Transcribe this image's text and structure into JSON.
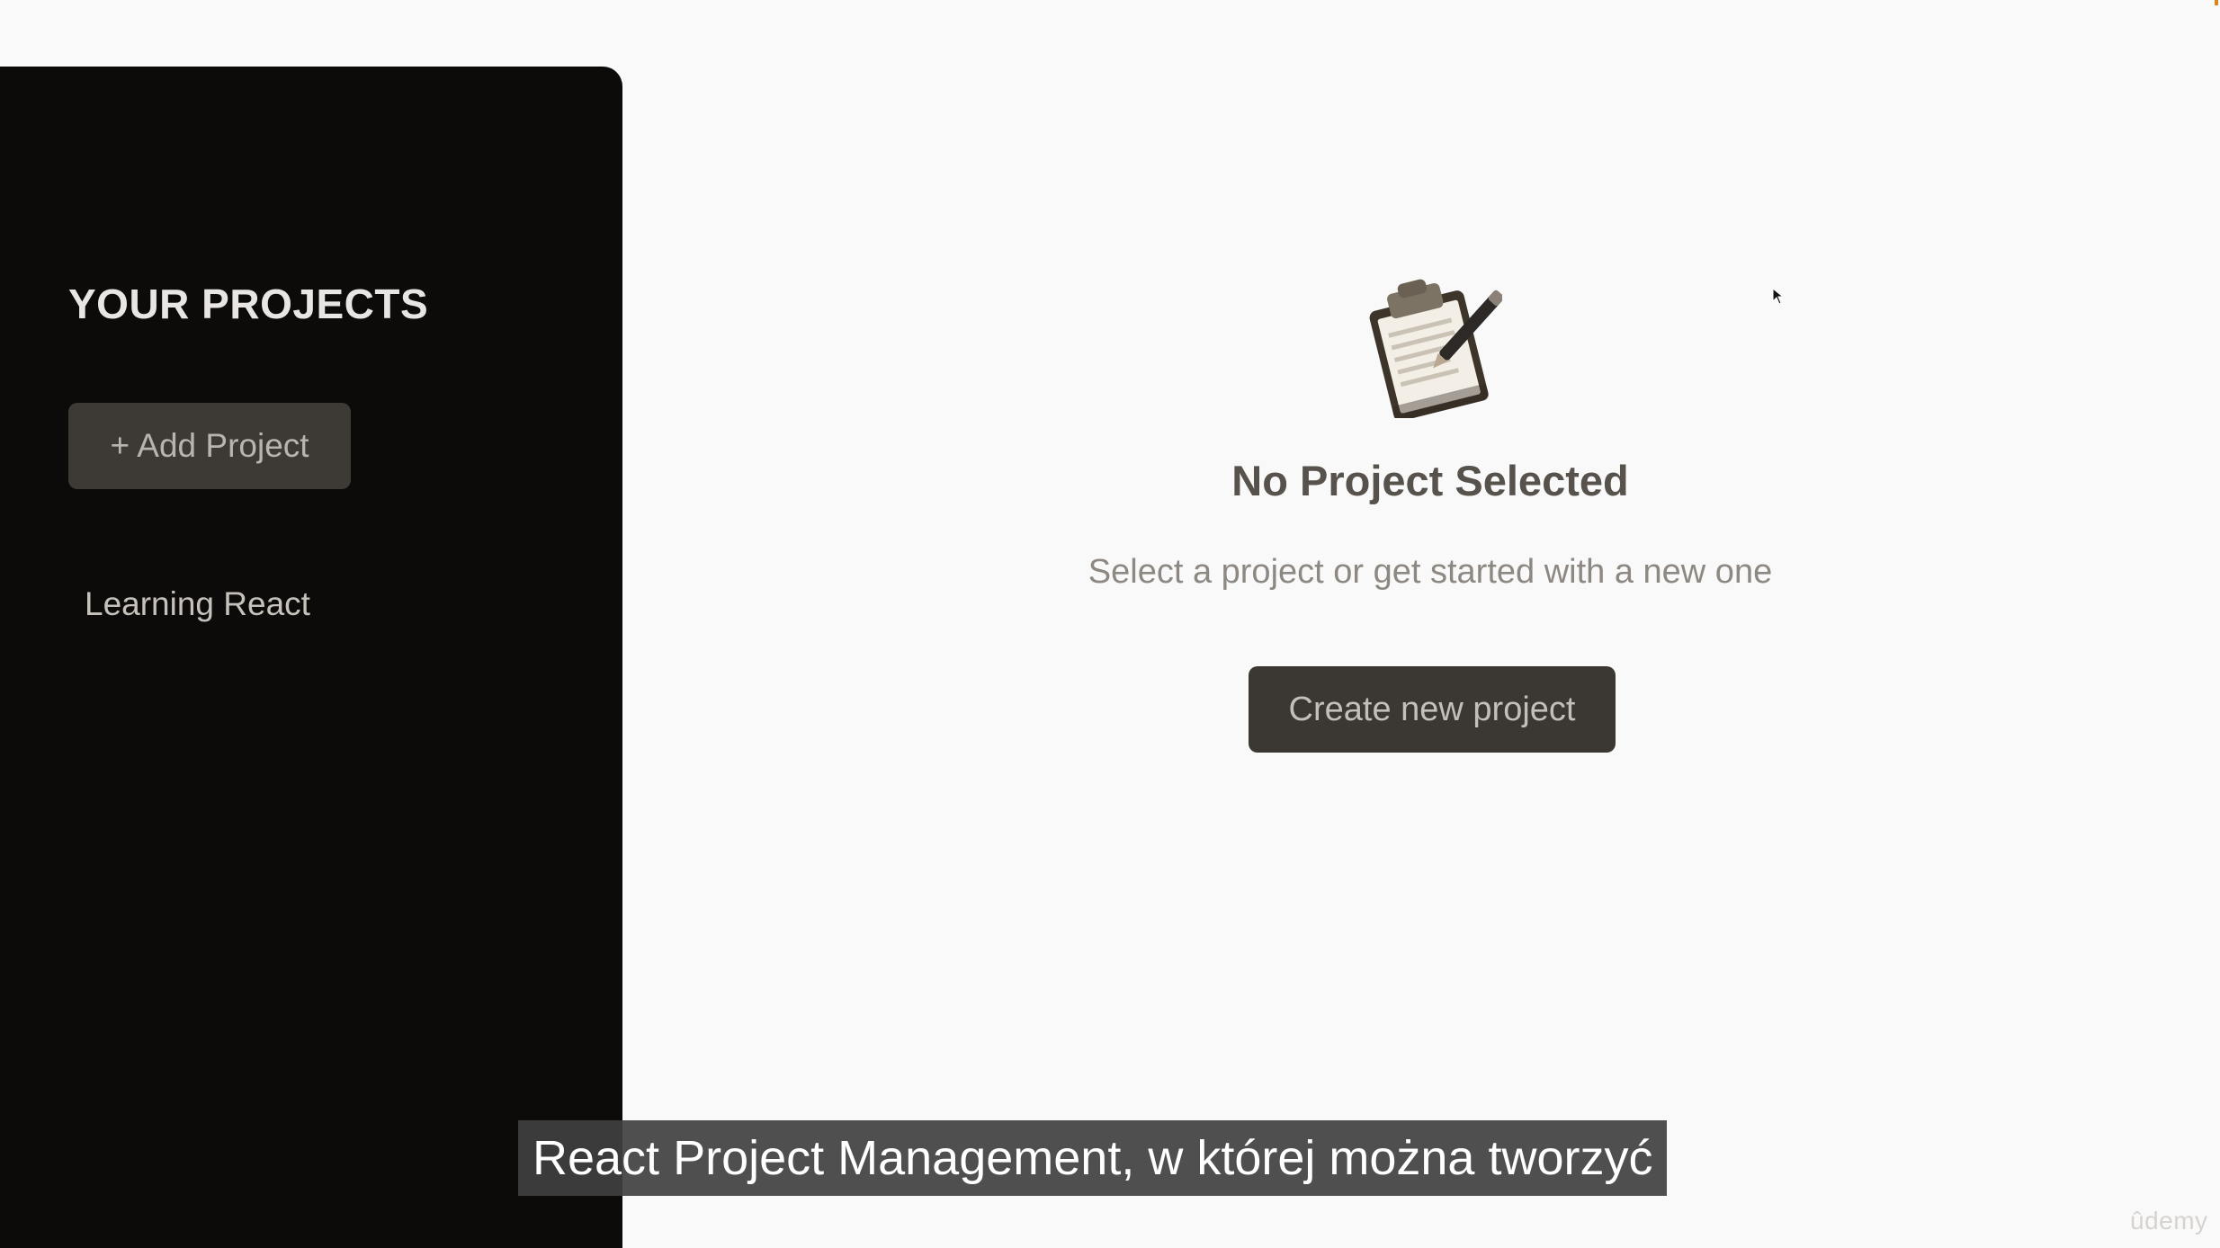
{
  "sidebar": {
    "title": "YOUR PROJECTS",
    "add_button_label": "+ Add Project",
    "projects": [
      {
        "label": "Learning React"
      }
    ]
  },
  "main": {
    "empty_title": "No Project Selected",
    "empty_subtitle": "Select a project or get started with a new one",
    "create_button_label": "Create new project",
    "illustration_icon": "clipboard-icon"
  },
  "overlay": {
    "caption": "React Project Management, w której można tworzyć",
    "watermark": "ûdemy"
  },
  "colors": {
    "sidebar_bg": "#0c0b0a",
    "button_bg": "#3d3935",
    "page_bg": "#f9f9f9"
  }
}
